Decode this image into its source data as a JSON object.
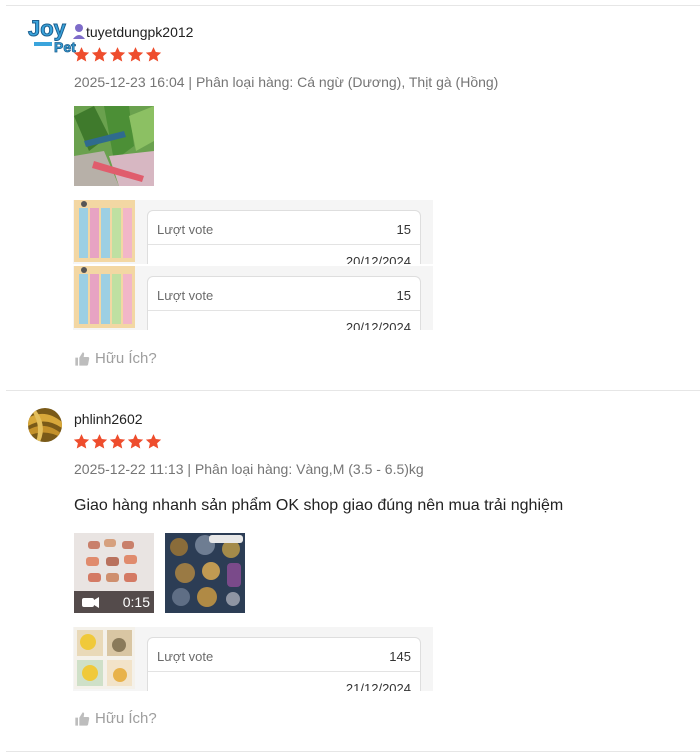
{
  "colors": {
    "star": "#ee4d2d",
    "meta": "#757575",
    "helpful": "#9e9e9e"
  },
  "reviews": [
    {
      "username": "tuyetdungpk2012",
      "logo_text": "Joy Pet",
      "rating": 5,
      "meta": "2025-12-23 16:04 | Phân loại hàng: Cá ngừ (Dương), Thịt gà (Hồng)",
      "votes": [
        {
          "label": "Lượt vote",
          "count": "15",
          "date": "20/12/2024"
        },
        {
          "label": "Lượt vote",
          "count": "15",
          "date": "20/12/2024"
        }
      ],
      "helpful": "Hữu Ích?"
    },
    {
      "username": "phlinh2602",
      "rating": 5,
      "meta": "2025-12-22 11:13 | Phân loại hàng: Vàng,M (3.5 - 6.5)kg",
      "comment": "Giao hàng nhanh sản phẩm OK shop giao đúng nên mua trải nghiệm",
      "video_duration": "0:15",
      "votes": [
        {
          "label": "Lượt vote",
          "count": "145",
          "date": "21/12/2024"
        }
      ],
      "helpful": "Hữu Ích?"
    }
  ]
}
